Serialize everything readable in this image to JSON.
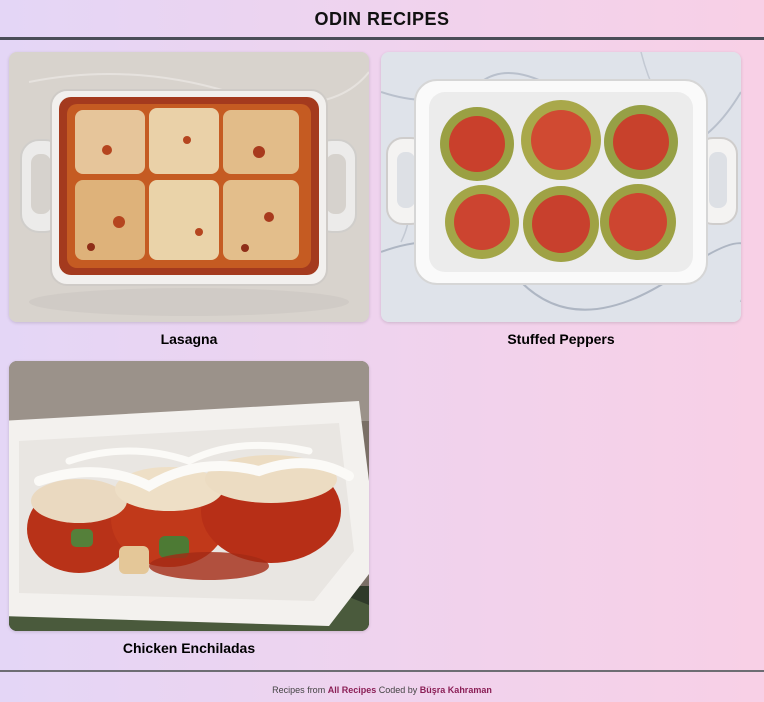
{
  "header": {
    "title": "ODIN RECIPES"
  },
  "recipes": [
    {
      "name": "Lasagna",
      "image": "lasagna-photo"
    },
    {
      "name": "Stuffed Peppers",
      "image": "stuffed-peppers-photo"
    },
    {
      "name": "Chicken Enchiladas",
      "image": "chicken-enchiladas-photo"
    }
  ],
  "footer": {
    "prefix": "Recipes from",
    "all_recipes_link": "All Recipes",
    "middle": "Coded by",
    "author_link": "Büşra Kahraman"
  },
  "colors": {
    "link": "#8b1f56",
    "header_border": "#4a4d57",
    "background_start": "#e4d6f6",
    "background_end": "#f8d0e6"
  }
}
